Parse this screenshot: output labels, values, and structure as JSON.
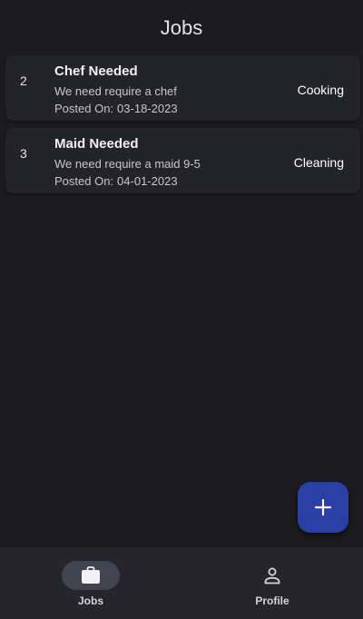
{
  "header": {
    "title": "Jobs"
  },
  "jobs": [
    {
      "id": "2",
      "title": "Chef Needed",
      "description": "We need require a chef",
      "posted_prefix": "Posted On:",
      "posted_date": "03-18-2023",
      "category": "Cooking"
    },
    {
      "id": "3",
      "title": "Maid Needed",
      "description": "We need require a maid 9-5",
      "posted_prefix": "Posted On:",
      "posted_date": "04-01-2023",
      "category": "Cleaning"
    }
  ],
  "fab": {
    "icon": "plus-icon"
  },
  "bottom_nav": {
    "items": [
      {
        "label": "Jobs",
        "icon": "briefcase-icon",
        "active": true
      },
      {
        "label": "Profile",
        "icon": "person-icon",
        "active": false
      }
    ]
  },
  "colors": {
    "background": "#1c1b1f",
    "card": "#232428",
    "fab": "#2b3ea6",
    "nav_bar": "#26252c",
    "nav_active_pill": "#41444f"
  }
}
